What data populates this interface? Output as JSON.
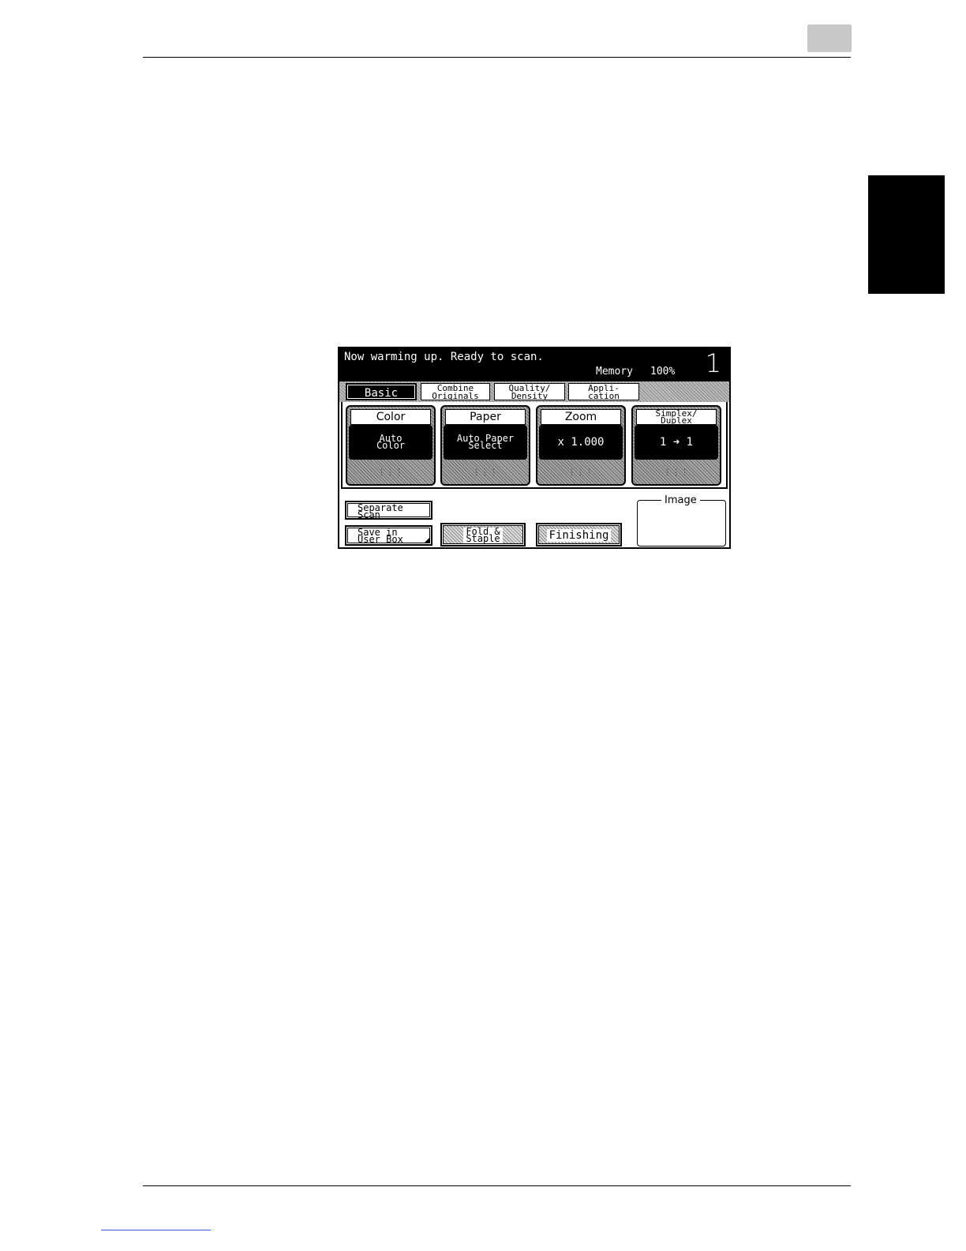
{
  "panel": {
    "message": "Now warming up. Ready to scan.",
    "memory_label": "Memory",
    "memory_value": "100%",
    "copy_count": "1"
  },
  "tabs": [
    {
      "line1": "Basic",
      "line2": ""
    },
    {
      "line1": "Combine",
      "line2": "Originals"
    },
    {
      "line1": "Quality/",
      "line2": "Density"
    },
    {
      "line1": "Appli-",
      "line2": "cation"
    }
  ],
  "functions": {
    "color": {
      "title": "Color",
      "value_line1": "Auto",
      "value_line2": "Color"
    },
    "paper": {
      "title": "Paper",
      "value_line1": "Auto Paper",
      "value_line2": "Select"
    },
    "zoom": {
      "title": "Zoom",
      "value": "x 1.000"
    },
    "simplex": {
      "title_line1": "Simplex/",
      "title_line2": "Duplex",
      "value": "1 ➜ 1"
    }
  },
  "buttons": {
    "separate_scan": {
      "line1": "Separate",
      "line2": "Scan"
    },
    "save_in_user_box": {
      "line1": "Save in",
      "line2": "User Box"
    },
    "fold_staple": {
      "line1": "Fold &",
      "line2": "Staple"
    },
    "finishing": "Finishing"
  },
  "image_frame_label": "Image"
}
